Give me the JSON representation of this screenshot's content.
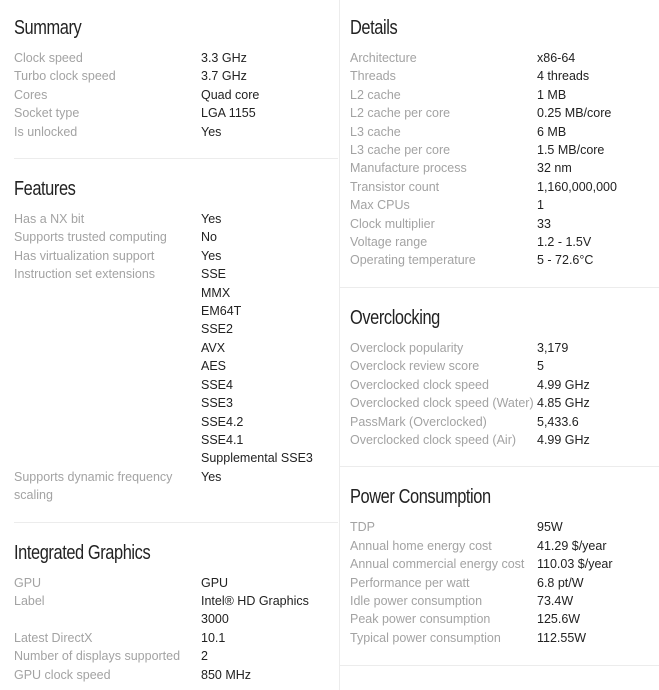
{
  "summary": {
    "title": "Summary",
    "rows": [
      {
        "label": "Clock speed",
        "value": "3.3 GHz"
      },
      {
        "label": "Turbo clock speed",
        "value": "3.7 GHz"
      },
      {
        "label": "Cores",
        "value": "Quad core"
      },
      {
        "label": "Socket type",
        "value": "LGA 1155"
      },
      {
        "label": "Is unlocked",
        "value": "Yes"
      }
    ]
  },
  "features": {
    "title": "Features",
    "rows": [
      {
        "label": "Has a NX bit",
        "value": "Yes"
      },
      {
        "label": "Supports trusted computing",
        "value": "No"
      },
      {
        "label": "Has virtualization support",
        "value": "Yes"
      }
    ],
    "instruction_set": {
      "label": "Instruction set extensions",
      "values": [
        "SSE",
        "MMX",
        "EM64T",
        "SSE2",
        "AVX",
        "AES",
        "SSE4",
        "SSE3",
        "SSE4.2",
        "SSE4.1",
        "Supplemental SSE3"
      ]
    },
    "dynamic_scaling": {
      "label": "Supports dynamic frequency scaling",
      "value": "Yes"
    }
  },
  "integrated_graphics": {
    "title": "Integrated Graphics",
    "rows": [
      {
        "label": "GPU",
        "value": "GPU"
      },
      {
        "label": "Label",
        "value": "Intel® HD Graphics 3000"
      },
      {
        "label": "Latest DirectX",
        "value": "10.1"
      },
      {
        "label": "Number of displays supported",
        "value": "2"
      },
      {
        "label": "GPU clock speed",
        "value": "850 MHz"
      }
    ]
  },
  "details": {
    "title": "Details",
    "rows": [
      {
        "label": "Architecture",
        "value": "x86-64"
      },
      {
        "label": "Threads",
        "value": "4 threads"
      },
      {
        "label": "L2 cache",
        "value": "1 MB"
      },
      {
        "label": "L2 cache per core",
        "value": "0.25 MB/core"
      },
      {
        "label": "L3 cache",
        "value": "6 MB"
      },
      {
        "label": "L3 cache per core",
        "value": "1.5 MB/core"
      },
      {
        "label": "Manufacture process",
        "value": "32 nm"
      },
      {
        "label": "Transistor count",
        "value": "1,160,000,000"
      },
      {
        "label": "Max CPUs",
        "value": "1"
      },
      {
        "label": "Clock multiplier",
        "value": "33"
      },
      {
        "label": "Voltage range",
        "value": "1.2 - 1.5V"
      },
      {
        "label": "Operating temperature",
        "value": "5 - 72.6°C"
      }
    ]
  },
  "overclocking": {
    "title": "Overclocking",
    "rows": [
      {
        "label": "Overclock popularity",
        "value": "3,179"
      },
      {
        "label": "Overclock review score",
        "value": "5"
      },
      {
        "label": "Overclocked clock speed",
        "value": "4.99 GHz"
      },
      {
        "label": "Overclocked clock speed (Water)",
        "value": "4.85 GHz"
      },
      {
        "label": "PassMark (Overclocked)",
        "value": "5,433.6"
      },
      {
        "label": "Overclocked clock speed (Air)",
        "value": "4.99 GHz"
      }
    ]
  },
  "power": {
    "title": "Power Consumption",
    "rows": [
      {
        "label": "TDP",
        "value": "95W"
      },
      {
        "label": "Annual home energy cost",
        "value": "41.29 $/year"
      },
      {
        "label": "Annual commercial energy cost",
        "value": "110.03 $/year"
      },
      {
        "label": "Performance per watt",
        "value": "6.8 pt/W"
      },
      {
        "label": "Idle power consumption",
        "value": "73.4W"
      },
      {
        "label": "Peak power consumption",
        "value": "125.6W"
      },
      {
        "label": "Typical power consumption",
        "value": "112.55W"
      }
    ]
  }
}
